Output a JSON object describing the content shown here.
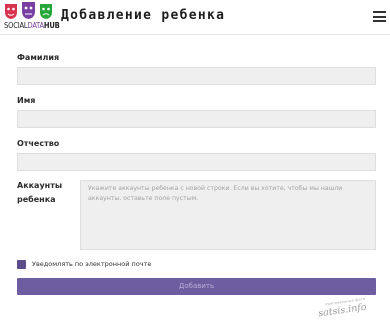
{
  "header": {
    "logo": {
      "prefix": "SOCIAL",
      "middle": "DATA",
      "suffix": "HUB",
      "colors": [
        "#d8344f",
        "#7a3fa3",
        "#27a63a",
        "#222222"
      ]
    },
    "title": "Добавление ребенка",
    "menu_icon": "hamburger-menu-icon"
  },
  "form": {
    "last_name_label": "Фамилия",
    "last_name_value": "",
    "first_name_label": "Имя",
    "first_name_value": "",
    "patronymic_label": "Отчество",
    "patronymic_value": "",
    "accounts_label_line1": "Аккаунты",
    "accounts_label_line2": "ребенка",
    "accounts_placeholder": "Укажите аккаунты ребенка с новой строки. Если вы хотите, чтобы мы нашли аккаунты, оставьте поле пустым.",
    "email_notify_label": "Уведомлять по электронной почте",
    "email_notify_checked": true,
    "submit_label": "Добавить",
    "accent_color": "#6c5ea0"
  },
  "watermark": {
    "top": "оригинальные фото",
    "main": "satsis.info"
  }
}
